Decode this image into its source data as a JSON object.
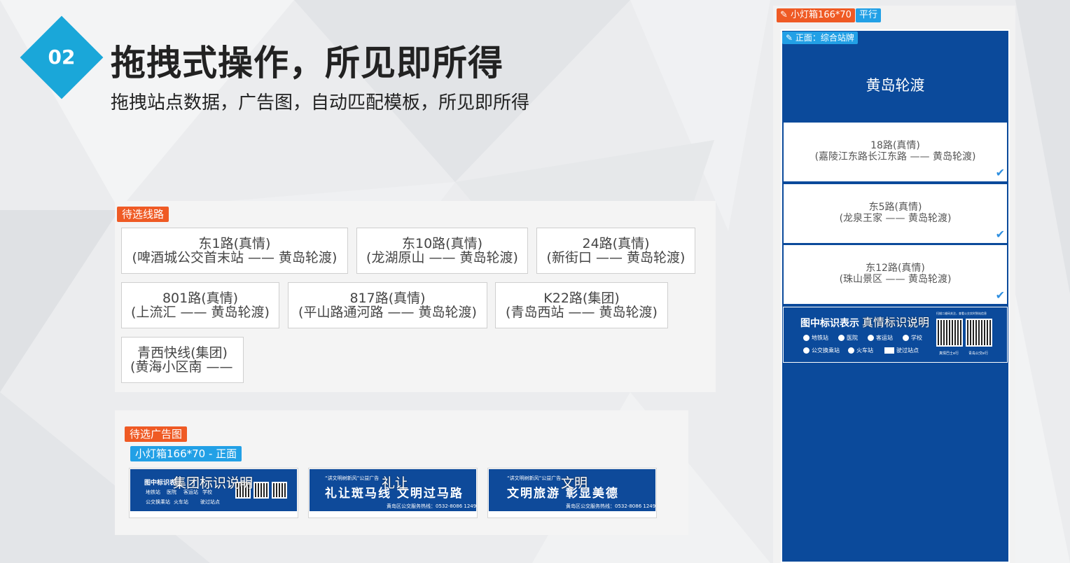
{
  "header": {
    "badge_number": "02",
    "title": "拖拽式操作，所见即所得",
    "subtitle": "拖拽站点数据，广告图，自动匹配模板，所见即所得"
  },
  "routes_panel": {
    "tag": "待选线路",
    "routes": [
      {
        "line1": "东1路(真情)",
        "line2": "(啤酒城公交首末站 —— 黄岛轮渡)"
      },
      {
        "line1": "东10路(真情)",
        "line2": "(龙湖原山 —— 黄岛轮渡)"
      },
      {
        "line1": "24路(真情)",
        "line2": "(新街口 —— 黄岛轮渡)"
      },
      {
        "line1": "801路(真情)",
        "line2": "(上流汇 —— 黄岛轮渡)"
      },
      {
        "line1": "817路(真情)",
        "line2": "(平山路通河路 —— 黄岛轮渡)"
      },
      {
        "line1": "K22路(集团)",
        "line2": "(青岛西站 —— 黄岛轮渡)"
      },
      {
        "line1": "青西快线(集团)",
        "line2": "(黄海小区南 ——"
      }
    ]
  },
  "ads_panel": {
    "tag": "待选广告图",
    "sub_tag": "小灯箱166*70 - 正面",
    "ads": [
      {
        "overlay": "集团标识说明",
        "title": "图中标识表示",
        "legend": [
          "地铁站",
          "医院",
          "客运站",
          "学校",
          "公交换乘站",
          "火车站",
          "驶过站点"
        ]
      },
      {
        "overlay": "礼让",
        "small": "“讲文明树新风”公益广告",
        "big": "礼让斑马线  文明过马路",
        "foot": "黄岛区公交服务热线：0532-8086 1249"
      },
      {
        "overlay": "文明",
        "small": "“讲文明树新风”公益广告",
        "big": "文明旅游  彰显美德",
        "foot": "黄岛区公交服务热线：0532-8086 1249"
      }
    ]
  },
  "board": {
    "size_tag": "小灯箱166*70",
    "parallel_tag": "平行",
    "face_tag": "正面：综合站牌",
    "station_name": "黄岛轮渡",
    "routes": [
      {
        "line1": "18路(真情)",
        "line2": "(嘉陵江东路长江东路 —— 黄岛轮渡)"
      },
      {
        "line1": "东5路(真情)",
        "line2": "(龙泉王家 —— 黄岛轮渡)"
      },
      {
        "line1": "东12路(真情)",
        "line2": "(珠山景区 —— 黄岛轮渡)"
      }
    ],
    "legend_title": "图中标识表示",
    "legend_overlay": "真情标识说明",
    "legend_items": [
      "地铁站",
      "医院",
      "客运站",
      "学校",
      "公交换乘站",
      "火车站",
      "驶过站点"
    ],
    "legend_note": "扫描二维码关注，查看公交实时到站信息",
    "qr_labels": [
      "真情巴士e行",
      "青岛公交e行"
    ]
  },
  "colors": {
    "accent_blue": "#1aa7d9",
    "tag_orange": "#ef5a24",
    "tag_blue": "#22a0e6",
    "board_blue": "#0b4a9b",
    "check_blue": "#2e8fe0"
  }
}
